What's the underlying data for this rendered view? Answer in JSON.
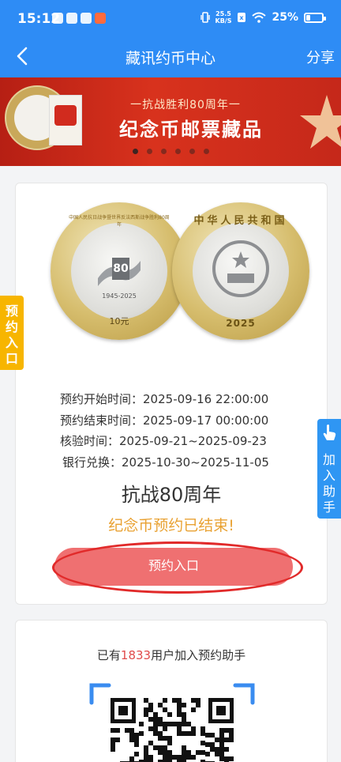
{
  "status": {
    "time": "15:12",
    "net_speed": "25.5",
    "net_unit": "KB/S",
    "battery": "25%",
    "battery_level": 0.25
  },
  "nav": {
    "title": "藏讯约币中心",
    "share": "分享"
  },
  "banner": {
    "subtitle": "一抗战胜利80周年一",
    "title": "纪念币邮票藏品",
    "slide_count": 6,
    "active_slide": 0
  },
  "coin": {
    "obverse_ring_text": "中国人民抗日战争暨世界反法西斯战争胜利80周年",
    "obverse_number": "80",
    "obverse_years": "1945-2025",
    "denomination": "10元",
    "reverse_ring_text": "中华人民共和国",
    "reverse_year": "2025"
  },
  "reservation": {
    "rows": [
      {
        "label": "预约开始时间：",
        "value": "2025-09-16 22:00:00"
      },
      {
        "label": "预约结束时间：",
        "value": "2025-09-17 00:00:00"
      },
      {
        "label": "核验时间：",
        "value": "2025-09-21~2025-09-23"
      },
      {
        "label": "银行兑换：",
        "value": "2025-10-30~2025-11-05"
      }
    ],
    "coin_name": "抗战80周年",
    "ended_text": "纪念币预约已结束!",
    "button_label": "预约入口"
  },
  "side": {
    "left_label": "预约入口",
    "right_label": "加入助手"
  },
  "helper": {
    "prefix": "已有",
    "count": "1833",
    "suffix": "用户加入预约助手"
  },
  "colors": {
    "header": "#2e8cf5",
    "button": "#ef7071",
    "ended": "#e9a233",
    "highlight_circle": "#e12a2a",
    "left_tab": "#f7b500",
    "right_tab": "#2f96f3"
  }
}
